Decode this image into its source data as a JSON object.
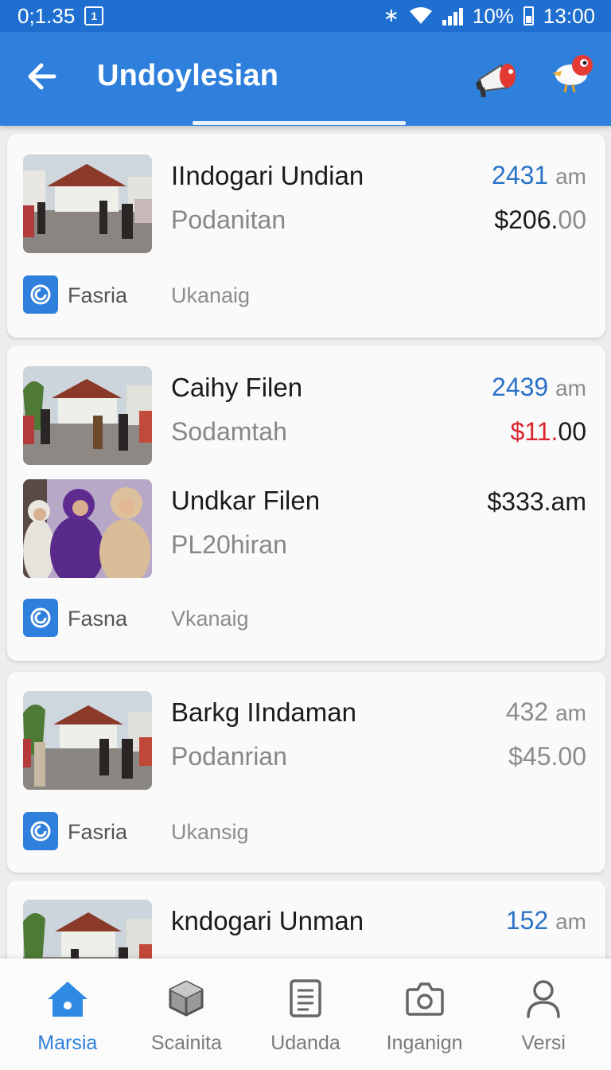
{
  "status_bar": {
    "time_left": "0;1.35",
    "battery": "10%",
    "clock": "13:00",
    "icons": [
      "app-notification-icon",
      "bluetooth-icon",
      "wifi-icon",
      "signal-icon",
      "battery-icon"
    ]
  },
  "app_bar": {
    "title": "Undoylesian",
    "back_icon": "arrow-left-icon",
    "actions": [
      "megaphone-icon",
      "bird-icon"
    ],
    "color": "#2f7fdc"
  },
  "cards": [
    {
      "rows": [
        {
          "title": "IIndogari Undian",
          "subtitle": "Podanitan",
          "time": "2431",
          "time_unit": "am",
          "price_main": "$206.",
          "price_dec": "00"
        }
      ],
      "brand": "Fasria",
      "tag": "Ukanaig"
    },
    {
      "rows": [
        {
          "title": "Caihy Filen",
          "subtitle": "Sodamtah",
          "time": "2439",
          "time_unit": "am",
          "price_main": "$11.",
          "price_dec": "00"
        },
        {
          "title": "Undkar Filen",
          "subtitle": "PL20hiran",
          "price_main": "$333.am"
        }
      ],
      "brand": "Fasna",
      "tag": "Vkanaig"
    },
    {
      "rows": [
        {
          "title": "Barkg IIndaman",
          "subtitle": "Podanrian",
          "time": "432",
          "time_unit": "am",
          "price_main": "$45.00"
        }
      ],
      "brand": "Fasria",
      "tag": "Ukansig"
    },
    {
      "rows": [
        {
          "title": "kndogari Unman",
          "time": "152",
          "time_unit": "am"
        }
      ]
    }
  ],
  "bottom_nav": [
    {
      "label": "Marsia",
      "icon": "home-icon",
      "active": true
    },
    {
      "label": "Scainita",
      "icon": "cube-icon",
      "active": false
    },
    {
      "label": "Udanda",
      "icon": "document-icon",
      "active": false
    },
    {
      "label": "Inganign",
      "icon": "camera-icon",
      "active": false
    },
    {
      "label": "Versi",
      "icon": "person-icon",
      "active": false
    }
  ],
  "colors": {
    "accent": "#2f7fdc",
    "time_blue": "#2a73c8",
    "price_red": "#d9262e"
  }
}
